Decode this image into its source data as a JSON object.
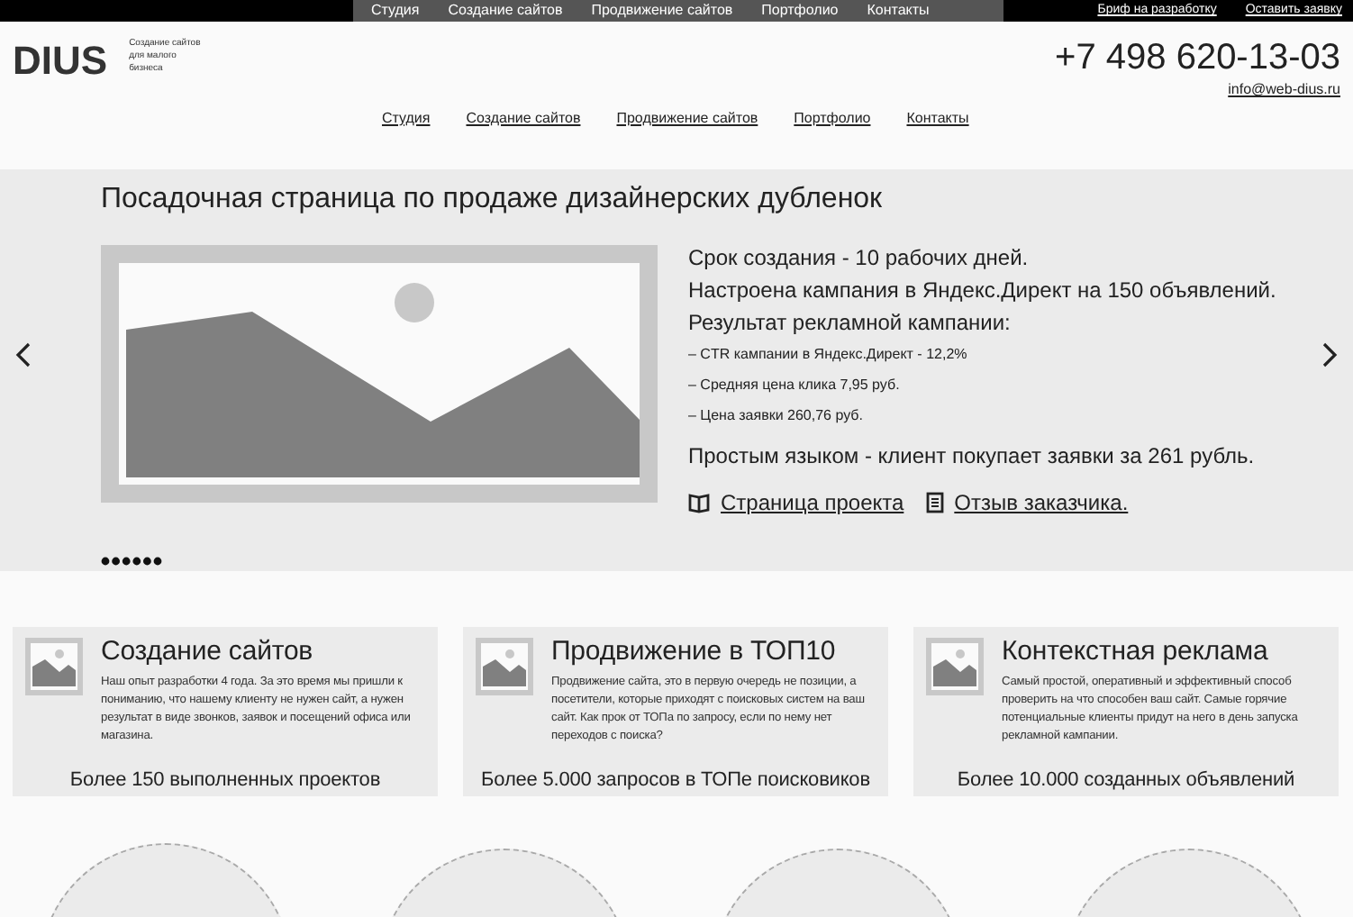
{
  "top_bar": {
    "nav": [
      "Студия",
      "Создание сайтов",
      "Продвижение сайтов",
      "Портфолио",
      "Контакты"
    ],
    "links": [
      "Бриф на разработку",
      "Оставить заявку"
    ]
  },
  "header": {
    "logo": "DIUS",
    "tagline": [
      "Создание сайтов",
      "для малого",
      "бизнеса"
    ],
    "phone": "+7 498 620-13-03",
    "email": "info@web-dius.ru",
    "nav": [
      "Студия",
      "Создание сайтов",
      "Продвижение сайтов",
      "Портфолио",
      "Контакты"
    ]
  },
  "slider": {
    "title": "Посадочная страница по продаже дизайнерских дубленок",
    "lines": [
      {
        "kind": "main",
        "text": "Срок создания - 10 рабочих дней."
      },
      {
        "kind": "main",
        "text": "Настроена кампания в Яндекс.Директ на 150 объявлений."
      },
      {
        "kind": "main",
        "text": "Результат рекламной кампании:"
      },
      {
        "kind": "small",
        "text": "– CTR кампании в Яндекс.Директ -  12,2%"
      },
      {
        "kind": "small",
        "text": "– Средняя цена клика 7,95 руб."
      },
      {
        "kind": "small",
        "text": "– Цена заявки 260,76 руб."
      },
      {
        "kind": "gap",
        "text": "Простым языком - клиент покупает заявки за 261 рубль."
      }
    ],
    "links": [
      {
        "kind": "book",
        "text": "Страница проекта"
      },
      {
        "kind": "document",
        "text": "Отзыв заказчика."
      }
    ]
  },
  "cards": [
    {
      "title": "Создание сайтов",
      "text": "Наш опыт разработки 4 года. За это время мы пришли к пониманию, что нашему клиенту не нужен сайт, а нужен результат в виде звонков, заявок и посещений офиса или магазина.",
      "footer": "Более 150 выполненных проектов"
    },
    {
      "title": "Продвижение в ТОП10",
      "text": "Продвижение сайта, это в первую очередь не позиции, а посетители, которые приходят с поисковых систем на ваш сайт. Как прок от ТОПа по запросу, если по нему нет переходов с поиска?",
      "footer": "Более 5.000 запросов в ТОПе поисковиков"
    },
    {
      "title": "Контекстная реклама",
      "text": "Самый простой, оперативный и эффективный способ проверить на что способен ваш сайт. Самые горячие потенциальные клиенты придут на него в день запуска рекламной кампании.",
      "footer": "Более 10.000 созданных объявлений"
    }
  ]
}
